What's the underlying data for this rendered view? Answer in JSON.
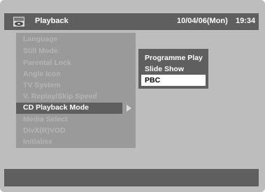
{
  "header": {
    "title": "Playback",
    "date": "10/04/06(Mon)",
    "time": "19:34",
    "icon": "disc-tray-icon"
  },
  "menu": {
    "items": [
      {
        "label": "Language"
      },
      {
        "label": "Still Mode"
      },
      {
        "label": "Parental Lock"
      },
      {
        "label": "Angle Icon"
      },
      {
        "label": "TV System"
      },
      {
        "label": "V. Replay/Skip Speed"
      },
      {
        "label": "CD Playback Mode"
      },
      {
        "label": "Media Select"
      },
      {
        "label": "DivX(R)VOD"
      },
      {
        "label": "Initialise"
      }
    ],
    "selected": "CD Playback Mode"
  },
  "submenu": {
    "items": [
      {
        "label": "Programme Play"
      },
      {
        "label": "Slide Show"
      },
      {
        "label": "PBC"
      }
    ],
    "selected": "PBC"
  },
  "colors": {
    "background": "#bdbdbd",
    "bar": "#5f5f5f",
    "menu_panel": "#9a9a9a",
    "dim_text": "#b4b4b4",
    "highlight": "#ffffff"
  }
}
